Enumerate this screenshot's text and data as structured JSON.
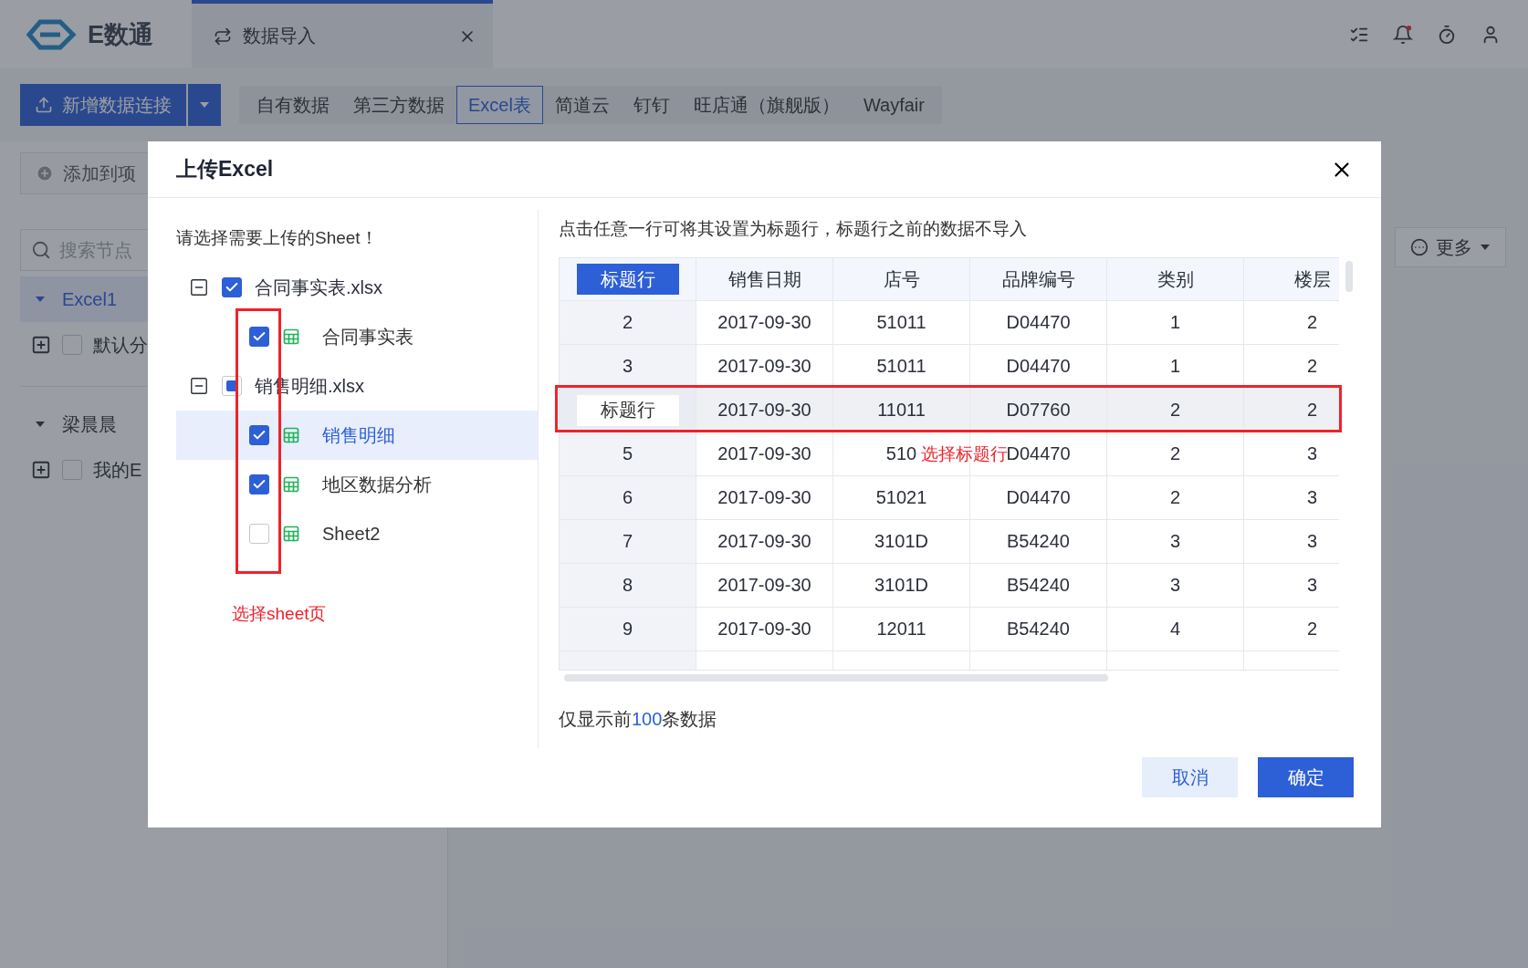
{
  "topbar": {
    "logo": "E数通",
    "tab": {
      "label": "数据导入"
    }
  },
  "toolbar": {
    "add_button": "新增数据连接",
    "source_tabs": [
      {
        "label": "自有数据",
        "selected": false
      },
      {
        "label": "第三方数据",
        "selected": false
      },
      {
        "label": "Excel表",
        "selected": true
      },
      {
        "label": "简道云",
        "selected": false
      },
      {
        "label": "钉钉",
        "selected": false
      },
      {
        "label": "旺店通（旗舰版）",
        "selected": false
      },
      {
        "label": "Wayfair",
        "selected": false
      }
    ]
  },
  "sidebar": {
    "add_button": "添加到项",
    "search": {
      "placeholder": "搜索节点"
    },
    "groups": [
      {
        "label": "Excel1",
        "expanded": true,
        "selected": true,
        "children": [
          {
            "label": "默认分",
            "expanded": false,
            "checked": false
          }
        ]
      },
      {
        "label": "梁晨晨",
        "expanded": true,
        "selected": false,
        "children": [
          {
            "label": "我的E",
            "expanded": false,
            "checked": false
          }
        ]
      }
    ]
  },
  "main": {
    "more_button": "更多"
  },
  "dialog": {
    "title": "上传Excel",
    "sheet_prompt": "请选择需要上传的Sheet！",
    "files": [
      {
        "name": "合同事实表.xlsx",
        "expanded": true,
        "checked": true,
        "mixed": false,
        "sheets": [
          {
            "name": "合同事实表",
            "checked": true,
            "selected": false
          }
        ]
      },
      {
        "name": "销售明细.xlsx",
        "expanded": true,
        "checked": false,
        "mixed": true,
        "sheets": [
          {
            "name": "销售明细",
            "checked": true,
            "selected": true
          },
          {
            "name": "地区数据分析",
            "checked": true,
            "selected": false
          },
          {
            "name": "Sheet2",
            "checked": false,
            "selected": false
          }
        ]
      }
    ],
    "sheet_annotation": "选择sheet页",
    "table_prompt": "点击任意一行可将其设置为标题行，标题行之前的数据不导入",
    "columns": [
      {
        "label": "标题行",
        "kind": "marker"
      },
      {
        "label": "销售日期",
        "kind": "text"
      },
      {
        "label": "店号",
        "kind": "text"
      },
      {
        "label": "品牌编号",
        "kind": "text"
      },
      {
        "label": "类别",
        "kind": "text"
      },
      {
        "label": "楼层",
        "kind": "text"
      }
    ],
    "rows": [
      {
        "cells": [
          "2",
          "2017-09-30",
          "51011",
          "D04470",
          "1",
          "2"
        ],
        "selected": false
      },
      {
        "cells": [
          "3",
          "2017-09-30",
          "51011",
          "D04470",
          "1",
          "2"
        ],
        "selected": false
      },
      {
        "cells": [
          "标题行",
          "2017-09-30",
          "11011",
          "D07760",
          "2",
          "2"
        ],
        "selected": true
      },
      {
        "cells": [
          "5",
          "2017-09-30",
          "510",
          "D04470",
          "2",
          "3"
        ],
        "selected": false
      },
      {
        "cells": [
          "6",
          "2017-09-30",
          "51021",
          "D04470",
          "2",
          "3"
        ],
        "selected": false
      },
      {
        "cells": [
          "7",
          "2017-09-30",
          "3101D",
          "B54240",
          "3",
          "3"
        ],
        "selected": false
      },
      {
        "cells": [
          "8",
          "2017-09-30",
          "3101D",
          "B54240",
          "3",
          "3"
        ],
        "selected": false
      },
      {
        "cells": [
          "9",
          "2017-09-30",
          "12011",
          "B54240",
          "4",
          "2"
        ],
        "selected": false
      }
    ],
    "row_annotation": "选择标题行",
    "footer": {
      "prefix": "仅显示前",
      "count": "100",
      "suffix": "条数据"
    },
    "buttons": {
      "cancel": "取消",
      "confirm": "确定"
    }
  }
}
